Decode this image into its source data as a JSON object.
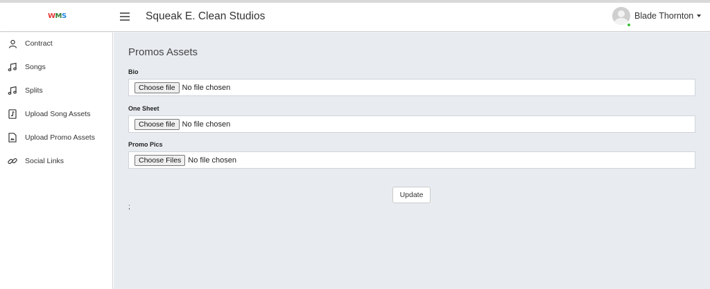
{
  "header": {
    "logo": {
      "letters": [
        "W",
        "M",
        "S"
      ],
      "colors": [
        "#e53935",
        "#2e7d32",
        "#1e88e5"
      ]
    },
    "menu_icon": "hamburger-icon",
    "app_title": "Squeak E. Clean Studios",
    "user": {
      "name": "Blade Thornton",
      "status_color": "#3cc13b",
      "avatar_icon": "avatar-icon",
      "caret_icon": "caret-down-icon"
    }
  },
  "sidebar": {
    "items": [
      {
        "label": "Contract",
        "icon": "user-icon"
      },
      {
        "label": "Songs",
        "icon": "music-note-icon"
      },
      {
        "label": "Splits",
        "icon": "music-note-icon"
      },
      {
        "label": "Upload Song Assets",
        "icon": "music-file-icon"
      },
      {
        "label": "Upload Promo Assets",
        "icon": "image-file-icon"
      },
      {
        "label": "Social Links",
        "icon": "link-icon"
      }
    ]
  },
  "main": {
    "title": "Promos Assets",
    "fields": [
      {
        "label": "Bio",
        "button": "Choose file",
        "status": "No file chosen"
      },
      {
        "label": "One Sheet",
        "button": "Choose file",
        "status": "No file chosen"
      },
      {
        "label": "Promo Pics",
        "button": "Choose Files",
        "status": "No file chosen"
      }
    ],
    "update_label": "Update",
    "stray_text": ";"
  },
  "colors": {
    "main_bg": "#e8ecf1",
    "sidebar_bg": "#ffffff"
  }
}
